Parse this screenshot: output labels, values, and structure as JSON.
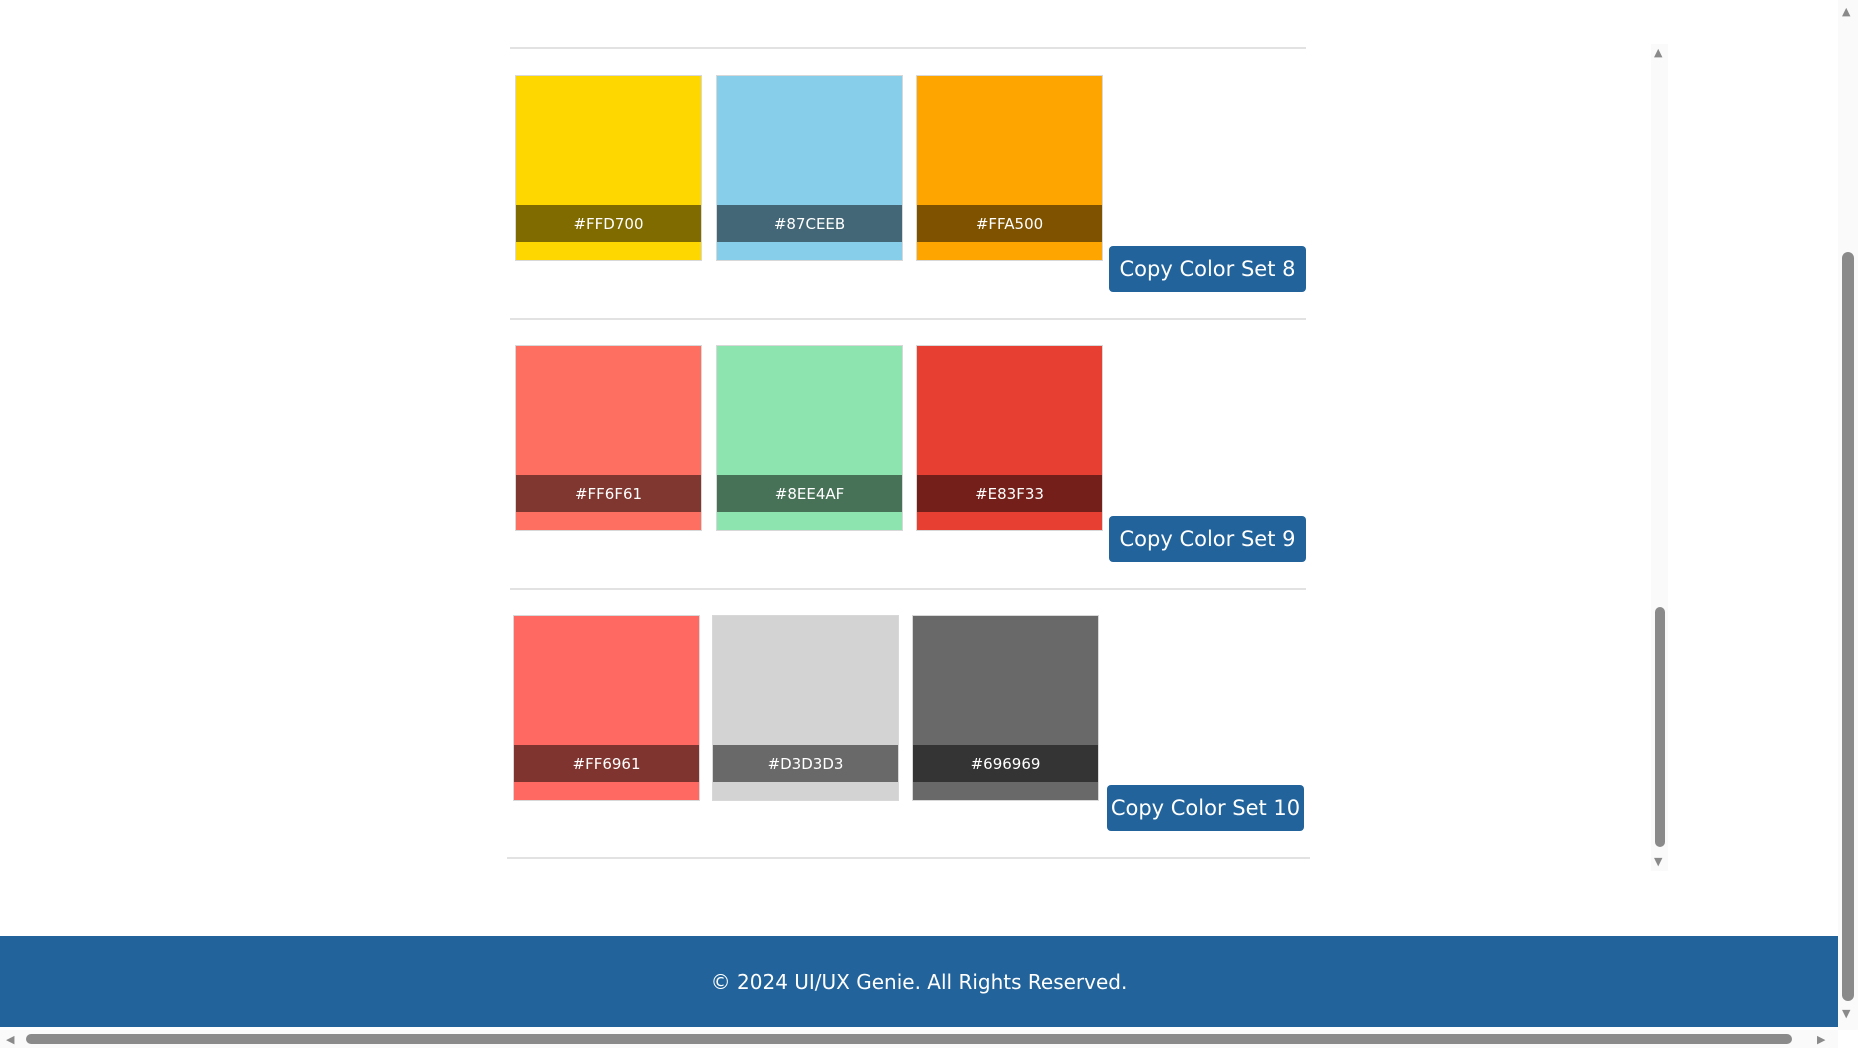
{
  "color_sets": [
    {
      "swatches": [
        {
          "hex": "#FFD700",
          "label_bg": "#7f6b00"
        },
        {
          "hex": "#87CEEB",
          "label_bg": "#436776"
        },
        {
          "hex": "#FFA500",
          "label_bg": "#7f5200"
        }
      ],
      "button": "Copy Color Set 8"
    },
    {
      "swatches": [
        {
          "hex": "#FF6F61",
          "label_bg": "#803730"
        },
        {
          "hex": "#8EE4AF",
          "label_bg": "#477257"
        },
        {
          "hex": "#E83F33",
          "label_bg": "#741f19"
        }
      ],
      "button": "Copy Color Set 9"
    },
    {
      "swatches": [
        {
          "hex": "#FF6961",
          "label_bg": "#803430"
        },
        {
          "hex": "#D3D3D3",
          "label_bg": "#696969"
        },
        {
          "hex": "#696969",
          "label_bg": "#343434"
        }
      ],
      "button": "Copy Color Set 10"
    }
  ],
  "footer": {
    "text": "© 2024 UI/UX Genie. All Rights Reserved."
  },
  "colors": {
    "accent": "#21639a"
  }
}
